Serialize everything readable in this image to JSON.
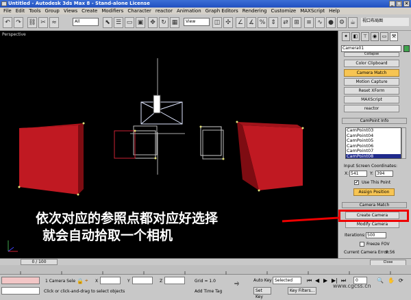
{
  "window": {
    "title": "Untitled - Autodesk 3ds Max 8 - Stand-alone License",
    "min": "_",
    "max": "□",
    "close": "×"
  },
  "menu": [
    "File",
    "Edit",
    "Tools",
    "Group",
    "Views",
    "Create",
    "Modifiers",
    "Character",
    "reactor",
    "Animation",
    "Graph Editors",
    "Rendering",
    "Customize",
    "MAXScript",
    "Help"
  ],
  "toolbar": {
    "selection_filter": "All",
    "ref_coord": "View",
    "named_selection": "视口布局图"
  },
  "viewport": {
    "label": "Perspective",
    "caption_line1": "依次对应的参照点都对应好选择",
    "caption_line2": "就会自动拾取一个相机"
  },
  "command_panel": {
    "object_name": "Camera01",
    "utility_header": "Collapse",
    "utility_buttons": [
      "Color Clipboard",
      "Camera Match",
      "Motion Capture",
      "Reset XForm",
      "MAXScript",
      "reactor"
    ],
    "campoint_title": "CamPoint Info",
    "campoints": [
      "CamPoint03",
      "CamPoint04",
      "CamPoint05",
      "CamPoint06",
      "CamPoint07",
      "CamPoint08"
    ],
    "selected_campoint": "CamPoint08",
    "input_coords_label": "Input Screen Coordinates:",
    "x_label": "X:",
    "x_value": "541",
    "y_label": "Y:",
    "y_value": "394",
    "use_this_point": "Use This Point",
    "use_this_point_checked": true,
    "assign_position": "Assign Position",
    "camera_match_title": "Camera Match",
    "create_camera": "Create Camera",
    "modify_camera": "Modify Camera",
    "iterations_label": "Iterations:",
    "iterations_value": "500",
    "freeze_fov": "Freeze FOV",
    "current_error_label": "Current Camera Error:",
    "current_error_value": "9.56",
    "close": "Close"
  },
  "timeline": {
    "slider": "0 / 100"
  },
  "status": {
    "selection": "1 Camera Sele",
    "x_label": "X",
    "y_label": "Y",
    "z_label": "Z",
    "grid": "Grid = 1.0",
    "prompt": "Click or click-and-drag to select objects",
    "add_time_tag": "Add Time Tag",
    "auto_key": "Auto Key",
    "set_key": "Set Key",
    "selected": "Selected",
    "key_filters": "Key Filters...",
    "frame": "0"
  },
  "watermark": "www.cgcss.cn"
}
